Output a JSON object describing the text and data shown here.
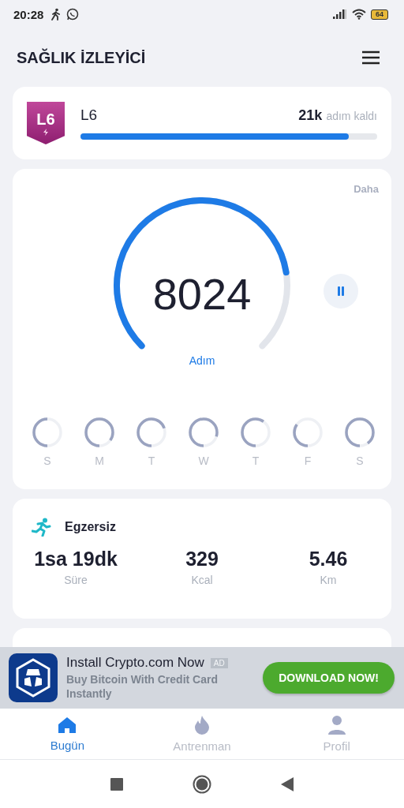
{
  "status_bar": {
    "time": "20:28",
    "battery": "64"
  },
  "header": {
    "title": "SAĞLIK İZLEYİCİ"
  },
  "level_card": {
    "badge": "L6",
    "name": "L6",
    "remaining_value": "21k",
    "remaining_label": "adım kaldı",
    "level": 0.905
  },
  "steps_card": {
    "more": "Daha",
    "count": "8024",
    "unit": "Adım",
    "days": [
      {
        "label": "S"
      },
      {
        "label": "M"
      },
      {
        "label": "T"
      },
      {
        "label": "W"
      },
      {
        "label": "T"
      },
      {
        "label": "F"
      },
      {
        "label": "S"
      }
    ]
  },
  "exercise_card": {
    "title": "Egzersiz",
    "stats": [
      {
        "value": "1sa 19dk",
        "label": "Süre"
      },
      {
        "value": "329",
        "label": "Kcal"
      },
      {
        "value": "5.46",
        "label": "Km"
      }
    ]
  },
  "ad": {
    "title": "Install Crypto.com Now",
    "tag": "AD",
    "text": "Buy Bitcoin With Credit Card Instantly",
    "button": "DOWNLOAD NOW!"
  },
  "bottom_nav": [
    {
      "label": "Bugün",
      "kind": "home",
      "selected": true
    },
    {
      "label": "Antrenman",
      "kind": "flame",
      "selected": false
    },
    {
      "label": "Profil",
      "kind": "person",
      "selected": false
    }
  ]
}
